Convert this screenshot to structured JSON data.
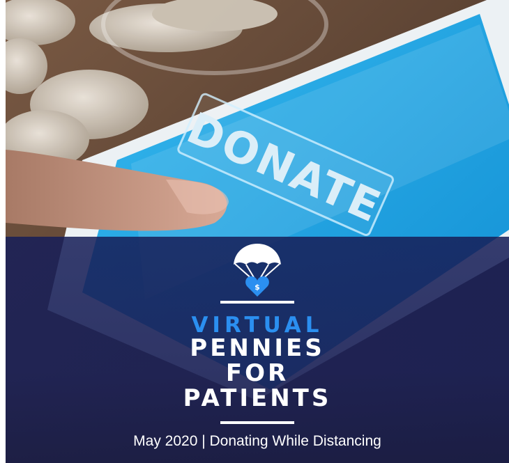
{
  "photo": {
    "screen_text": "DONATE",
    "colors": {
      "screen": "#1aa8e6",
      "wood": "#5b4330",
      "coin": "#d8cfc2"
    }
  },
  "title": {
    "line1": "VIRTUAL",
    "line2": "PENNIES",
    "line3": "FOR",
    "line4": "PATIENTS"
  },
  "logo": {
    "icon": "parachute-heart-dollar-icon",
    "symbol": "$",
    "color": "#2b8ff0"
  },
  "subtitle": "May 2020 | Donating While Distancing",
  "colors": {
    "accent": "#2b8ff0",
    "band": "#1c2160",
    "text": "#ffffff"
  }
}
